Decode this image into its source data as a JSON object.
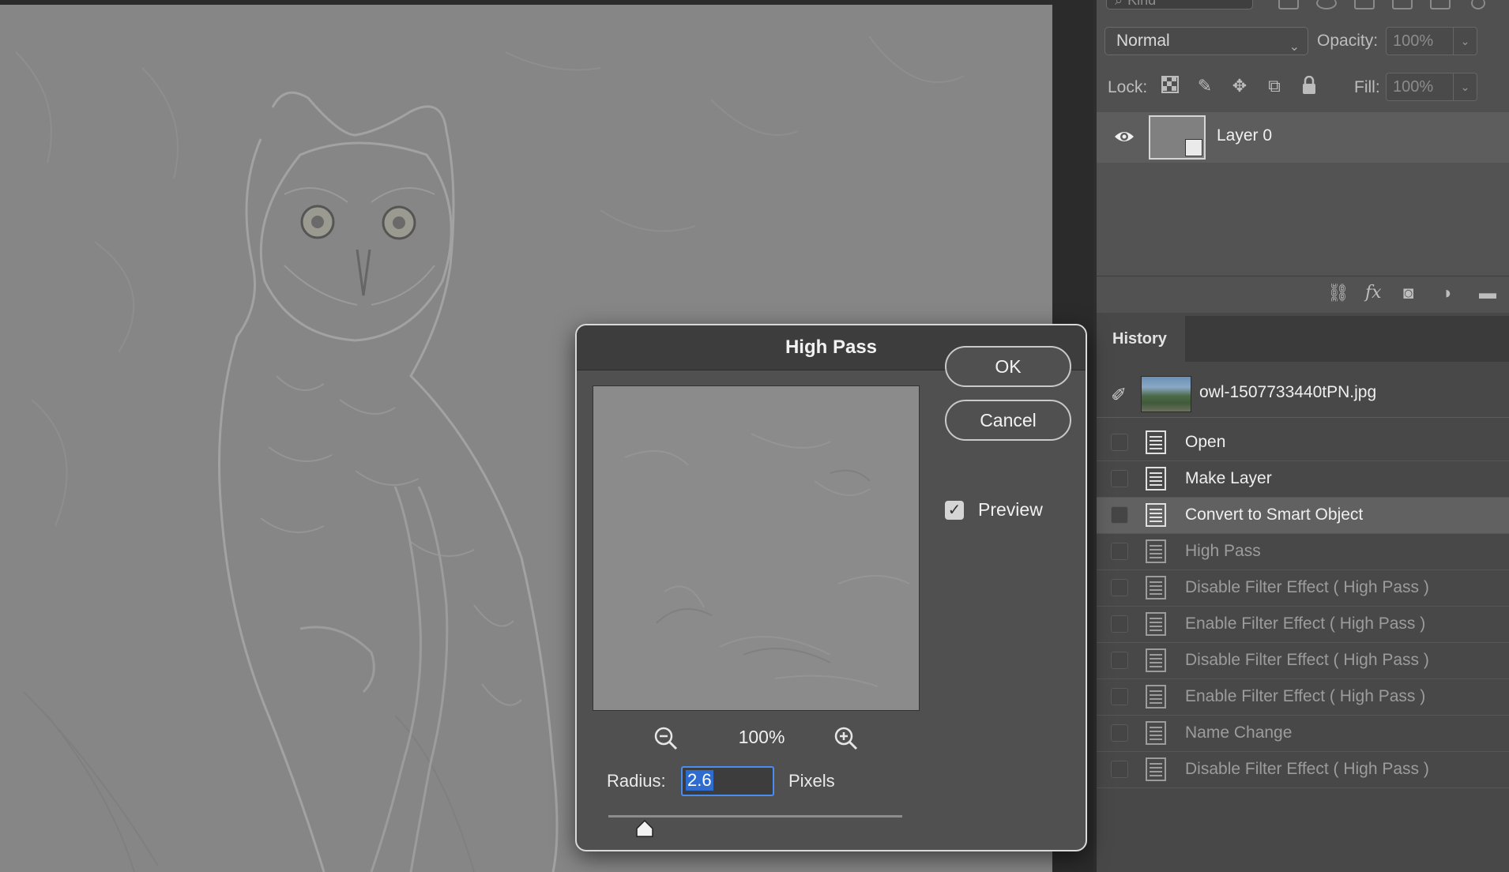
{
  "layers": {
    "kind_label": "Kind",
    "blend_mode": "Normal",
    "opacity_label": "Opacity:",
    "opacity_value": "100%",
    "lock_label": "Lock:",
    "fill_label": "Fill:",
    "fill_value": "100%",
    "layer_name": "Layer 0",
    "footer_fx": "fx"
  },
  "history": {
    "tab_label": "History",
    "snapshot_name": "owl-1507733440tPN.jpg",
    "items": [
      {
        "label": "Open",
        "state": "active"
      },
      {
        "label": "Make Layer",
        "state": "active"
      },
      {
        "label": "Convert to Smart Object",
        "state": "selected"
      },
      {
        "label": "High Pass",
        "state": "inactive"
      },
      {
        "label": "Disable Filter Effect ( High Pass )",
        "state": "inactive"
      },
      {
        "label": "Enable Filter Effect ( High Pass )",
        "state": "inactive"
      },
      {
        "label": "Disable Filter Effect ( High Pass )",
        "state": "inactive"
      },
      {
        "label": "Enable Filter Effect ( High Pass )",
        "state": "inactive"
      },
      {
        "label": "Name Change",
        "state": "inactive"
      },
      {
        "label": "Disable Filter Effect ( High Pass )",
        "state": "inactive"
      }
    ]
  },
  "dialog": {
    "title": "High Pass",
    "ok_label": "OK",
    "cancel_label": "Cancel",
    "preview_label": "Preview",
    "preview_checked": true,
    "zoom_level": "100%",
    "radius_label": "Radius:",
    "radius_value": "2.6",
    "radius_unit": "Pixels"
  }
}
